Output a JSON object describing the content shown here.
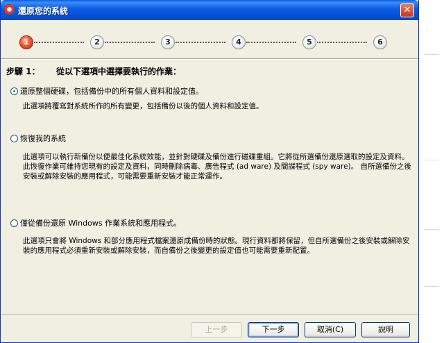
{
  "window": {
    "title": "還原您的系統",
    "close_glyph": "✕"
  },
  "steps": [
    {
      "label": "1",
      "active": true
    },
    {
      "label": "2",
      "active": false
    },
    {
      "label": "3",
      "active": false
    },
    {
      "label": "4",
      "active": false
    },
    {
      "label": "5",
      "active": false
    },
    {
      "label": "6",
      "active": false
    }
  ],
  "main": {
    "step_label": "步驟 1：",
    "step_title": "從以下選項中選擇要執行的作業：",
    "options": [
      {
        "label": "還原整個硬碟，包括備份中的所有個人資料和設定值。",
        "selected": true,
        "description": "此選項將覆寫對系統所作的所有變更，包括備份以後的個人資料和設定值。"
      },
      {
        "label": "恢復我的系統",
        "selected": false,
        "description": "此選項可以執行新備份以便最佳化系統效能，並針對硬碟及備份進行磁碟重組。它將從所選備份還原選取的設定及資料。此恢復作業可維持您現有的設定及資料，同時刪除病毒、廣告程式 (ad ware) 及間諜程式 (spy ware)。 自所選備份之後安裝或解除安裝的應用程式，可能需要重新安裝才能正常運作。"
      },
      {
        "label": "僅從備份還原 Windows 作業系統和應用程式。",
        "selected": false,
        "description": "此選項只會將 Windows 和部分應用程式檔案還原成備份時的狀態。現行資料都將保留，但自所選備份之後安裝或解除安裝的應用程式必須重新安裝或解除安裝，而自備份之後變更的設定值也可能需要重新配置。"
      }
    ]
  },
  "buttons": {
    "back": "上一步",
    "next": "下一步",
    "cancel": "取消(C)",
    "help": "說明"
  },
  "colors": {
    "titlebar": "#0654d9",
    "dialog_bg": "#f1efe2",
    "active_step": "#ef5b34"
  }
}
